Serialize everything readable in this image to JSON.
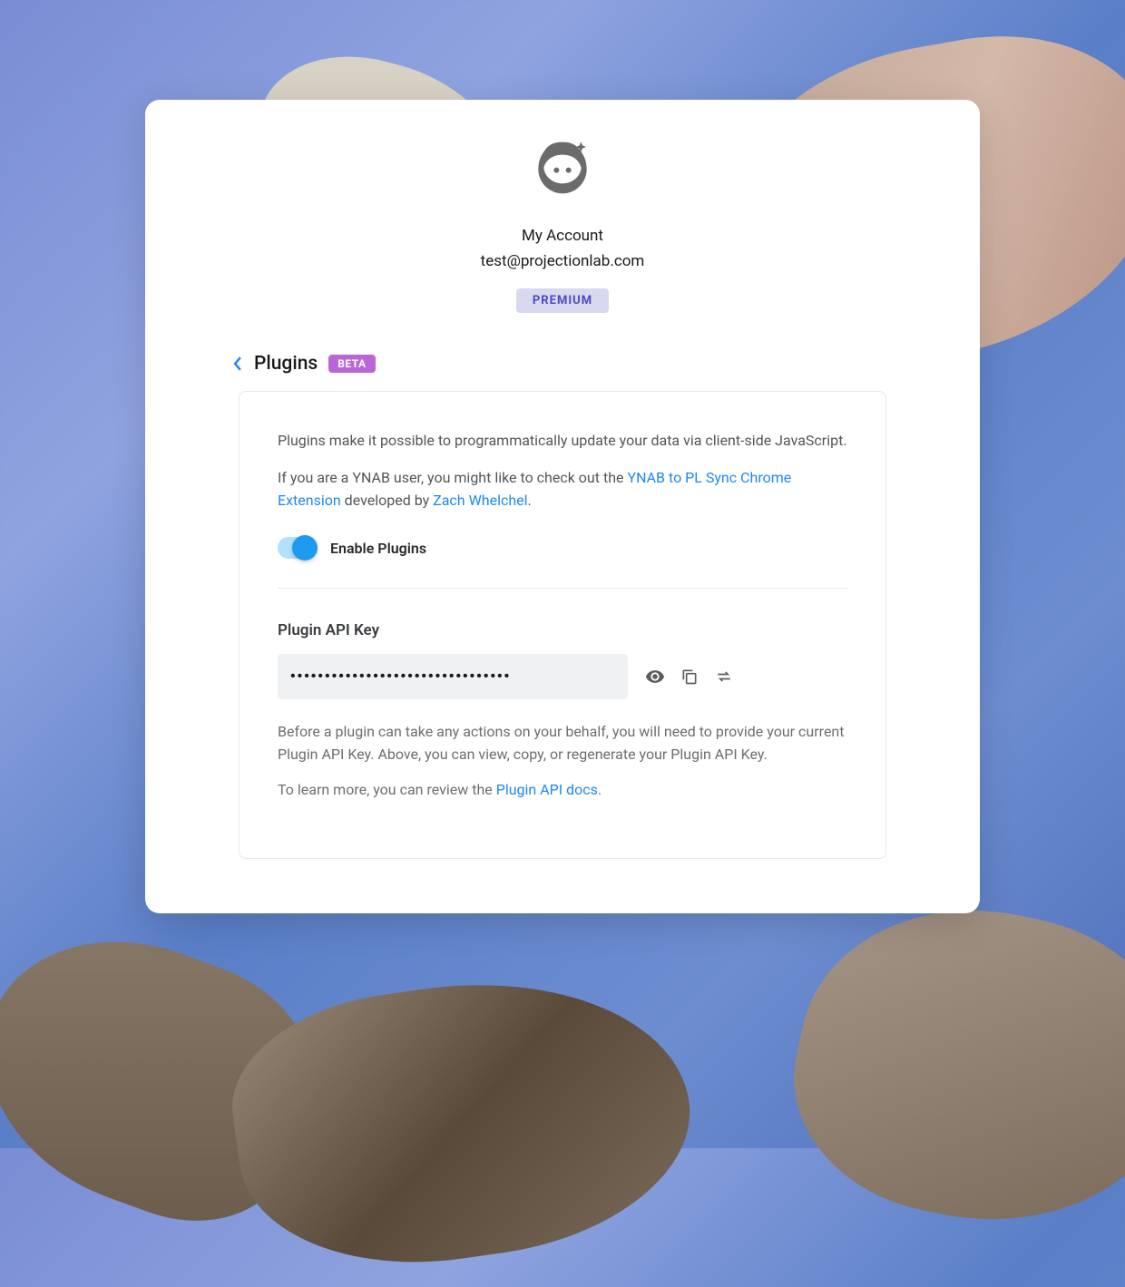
{
  "account": {
    "title": "My Account",
    "email": "test@projectionlab.com",
    "tier": "PREMIUM"
  },
  "section": {
    "title": "Plugins",
    "badge": "BETA"
  },
  "panel": {
    "intro": "Plugins make it possible to programmatically update your data via client-side JavaScript.",
    "ynab_prefix": "If you are a YNAB user, you might like to check out the ",
    "ynab_link_text": "YNAB to PL Sync Chrome Extension",
    "ynab_mid": " developed by ",
    "ynab_author": "Zach Whelchel",
    "ynab_suffix": ".",
    "toggle_label": "Enable Plugins",
    "api_key_label": "Plugin API Key",
    "api_key_value": "••••••••••••••••••••••••••••••••",
    "help1": "Before a plugin can take any actions on your behalf, you will need to provide your current Plugin API Key. Above, you can view, copy, or regenerate your Plugin API Key.",
    "help2_prefix": "To learn more, you can review the ",
    "help2_link": "Plugin API docs",
    "help2_suffix": "."
  }
}
